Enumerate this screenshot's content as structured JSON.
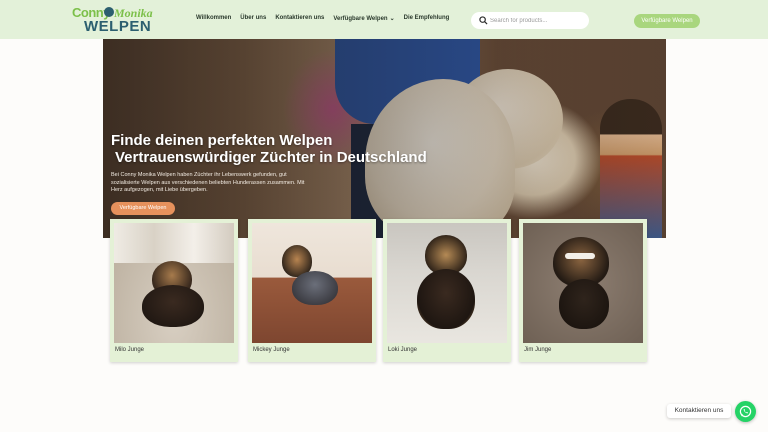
{
  "header": {
    "logo": {
      "line1": "Conny",
      "line1b": "Monika",
      "line2": "WELPEN"
    },
    "nav": [
      {
        "label": "Willkommen"
      },
      {
        "label": "Über uns"
      },
      {
        "label": "Kontaktieren uns"
      },
      {
        "label": "Verfügbare Welpen"
      },
      {
        "label": "Die Empfehlung"
      }
    ],
    "search": {
      "placeholder": "Search for products...",
      "icon": "search-icon"
    },
    "cta_label": "Verfügbare Welpen"
  },
  "hero": {
    "title_line1": "Finde deinen perfekten Welpen",
    "title_line2": "Vertrauenswürdiger Züchter in Deutschland",
    "text": "Bei Conny Monika Welpen haben Züchter ihr Lebenswerk gefunden, gut sozialisierte Welpen aus verschiedenen beliebten Hunderassen zusammen. Mit Herz aufgezogen, mit Liebe übergeben.",
    "cta_label": "Verfügbare Welpen"
  },
  "puppies": [
    {
      "name": "Milo Junge"
    },
    {
      "name": "Mickey Junge"
    },
    {
      "name": "Loki Junge"
    },
    {
      "name": "Jim Junge"
    }
  ],
  "whatsapp": {
    "label": "Kontaktieren uns",
    "icon": "whatsapp-icon"
  },
  "colors": {
    "header_bg": "#e3f1d9",
    "accent_green": "#a9d67e",
    "accent_orange": "#e6915c",
    "card_bg": "#e4f1d6",
    "whatsapp": "#25d366"
  }
}
